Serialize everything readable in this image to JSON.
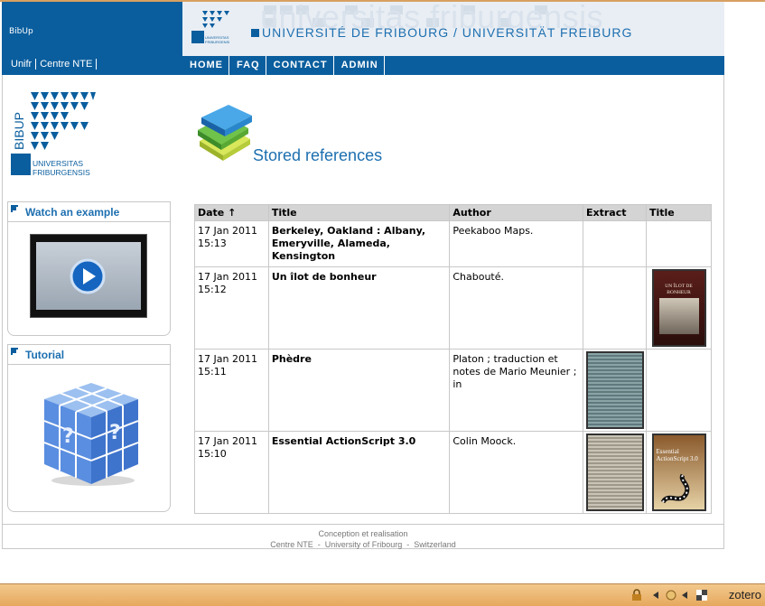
{
  "app": {
    "title": "BibUp"
  },
  "header": {
    "watermark": "universitas friburgensis",
    "title": "UNIVERSITÉ DE FRIBOURG / UNIVERSITÄT FREIBURG"
  },
  "nav": {
    "left": [
      "Unifr",
      "Centre NTE"
    ],
    "main": [
      "HOME",
      "FAQ",
      "CONTACT",
      "ADMIN"
    ]
  },
  "logo": {
    "vertical_text": "BIBUP",
    "line1": "UNIVERSITAS",
    "line2": "FRIBURGENSIS"
  },
  "page": {
    "title": "Stored references"
  },
  "sidebar": {
    "example_title": "Watch an example",
    "tutorial_title": "Tutorial"
  },
  "table": {
    "headers": {
      "date": "Date",
      "sort_icon": "↑",
      "title": "Title",
      "author": "Author",
      "extract": "Extract",
      "cover": "Title"
    },
    "rows": [
      {
        "date": "17 Jan 2011",
        "time": "15:13",
        "title": "Berkeley, Oakland : Albany, Emeryville, Alameda, Kensington",
        "author": "Peekaboo Maps."
      },
      {
        "date": "17 Jan 2011",
        "time": "15:12",
        "title": "Un îlot de bonheur",
        "author": "Chabouté.",
        "cover_text": "UN ÎLOT DE BONHEUR"
      },
      {
        "date": "17 Jan 2011",
        "time": "15:11",
        "title": "Phèdre",
        "author": "Platon ; traduction et notes de Mario Meunier ; in"
      },
      {
        "date": "17 Jan 2011",
        "time": "15:10",
        "title": "Essential ActionScript 3.0",
        "author": "Colin Moock.",
        "cover_text": "Essential ActionScript 3.0"
      }
    ]
  },
  "footer": {
    "line1": "Conception et realisation",
    "line2": "Centre NTE  -  University of Fribourg  -  Switzerland"
  },
  "statusbar": {
    "zotero": "zotero"
  }
}
